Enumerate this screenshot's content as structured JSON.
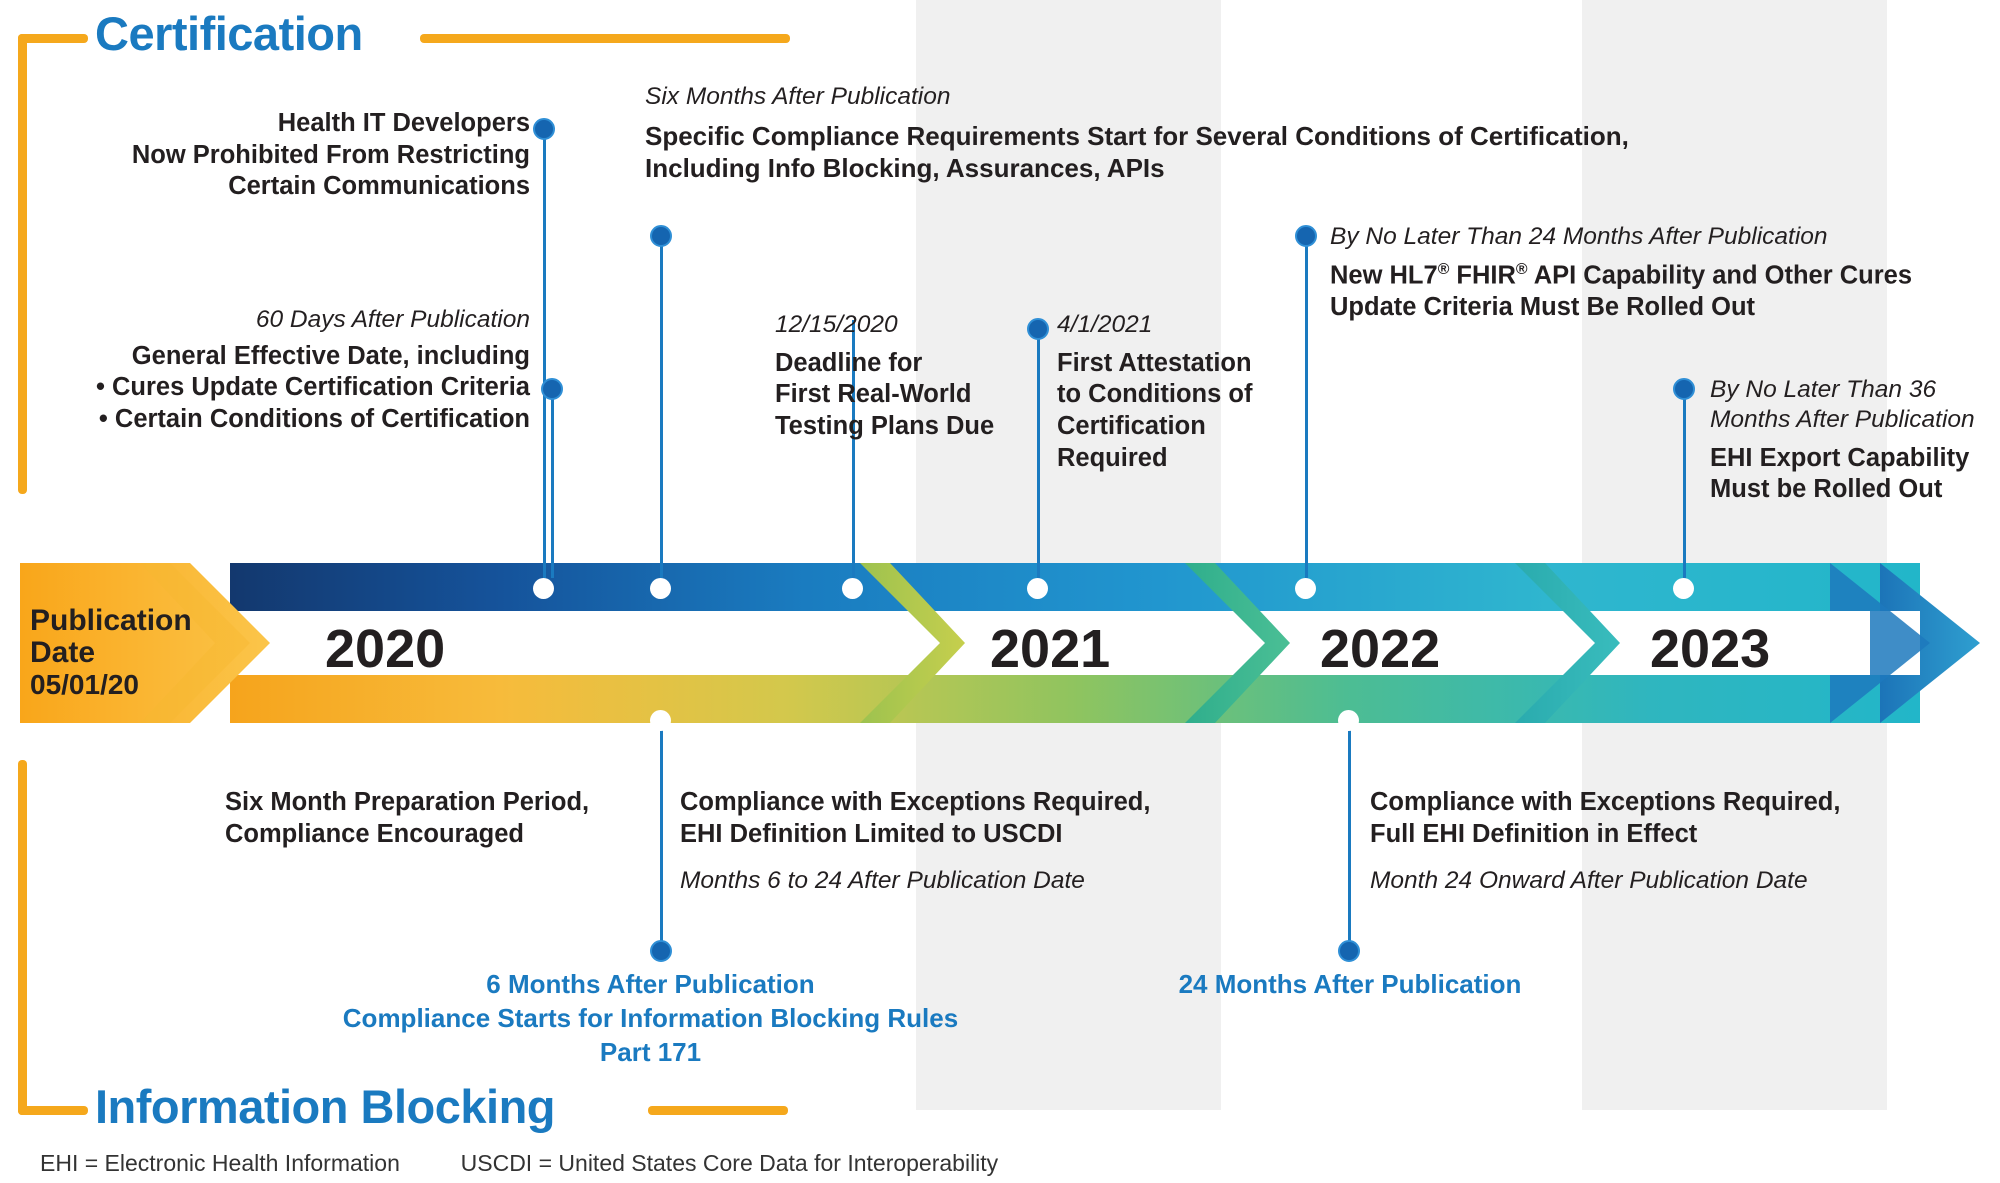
{
  "sections": {
    "top_title": "Certification",
    "bottom_title": "Information Blocking"
  },
  "publication": {
    "line1": "Publication",
    "line2": "Date",
    "date": "05/01/20"
  },
  "years": [
    "2020",
    "2021",
    "2022",
    "2023"
  ],
  "colors": {
    "accent_blue": "#1a7ac0",
    "accent_orange": "#f5a81c",
    "dot_blue": "#1565b0",
    "band_gray": "#f0f0f0",
    "text_dark": "#231f20"
  },
  "certification_events": [
    {
      "id": "health-it-developers",
      "timing": "",
      "title_lines": [
        "Health IT Developers",
        "Now Prohibited From Restricting",
        "Certain Communications"
      ],
      "bullets": []
    },
    {
      "id": "general-effective-date",
      "timing": "60 Days After Publication",
      "title_lines": [
        "General Effective Date, including"
      ],
      "bullets": [
        "• Cures Update Certification Criteria",
        "• Certain Conditions of Certification"
      ]
    },
    {
      "id": "specific-compliance-requirements",
      "timing": "Six Months After Publication",
      "title_lines": [
        "Specific Compliance Requirements Start for Several Conditions of Certification,",
        "Including Info Blocking, Assurances, APIs"
      ],
      "bullets": []
    },
    {
      "id": "real-world-testing-plans",
      "timing": "12/15/2020",
      "title_lines": [
        "Deadline for",
        "First Real-World",
        "Testing Plans Due"
      ],
      "bullets": []
    },
    {
      "id": "first-attestation",
      "timing": "4/1/2021",
      "title_lines": [
        "First Attestation",
        "to Conditions of",
        "Certification",
        "Required"
      ],
      "bullets": []
    },
    {
      "id": "hl7-fhir-api",
      "timing": "By No Later Than 24 Months After Publication",
      "title_lines": [
        "New HL7® FHIR® API Capability and Other Cures",
        "Update Criteria Must Be Rolled Out"
      ],
      "bullets": []
    },
    {
      "id": "ehi-export-capability",
      "timing_lines": [
        "By No Later Than 36",
        "Months After Publication"
      ],
      "timing": "By No Later Than 36 Months After Publication",
      "title_lines": [
        "EHI Export Capability",
        "Must be Rolled Out"
      ],
      "bullets": []
    }
  ],
  "info_blocking_events": [
    {
      "id": "six-month-preparation",
      "title_lines": [
        "Six Month Preparation Period,",
        "Compliance Encouraged"
      ],
      "timing": ""
    },
    {
      "id": "compliance-exceptions-uscdi",
      "title_lines": [
        "Compliance with Exceptions Required,",
        "EHI Definition Limited to USCDI"
      ],
      "timing": "Months 6 to 24 After Publication Date"
    },
    {
      "id": "compliance-exceptions-full-ehi",
      "title_lines": [
        "Compliance with Exceptions Required,",
        "Full EHI Definition in Effect"
      ],
      "timing": "Month 24 Onward After Publication Date"
    }
  ],
  "info_blocking_highlights": [
    {
      "id": "six-months-after-publication",
      "lines": [
        "6 Months After Publication",
        "Compliance Starts for Information Blocking Rules",
        "Part 171"
      ]
    },
    {
      "id": "twenty-four-months-after-publication",
      "lines": [
        "24 Months After Publication"
      ]
    }
  ],
  "footnotes": {
    "ehi": "EHI = Electronic Health Information",
    "uscdi": "USCDI = United States Core Data for Interoperability"
  }
}
